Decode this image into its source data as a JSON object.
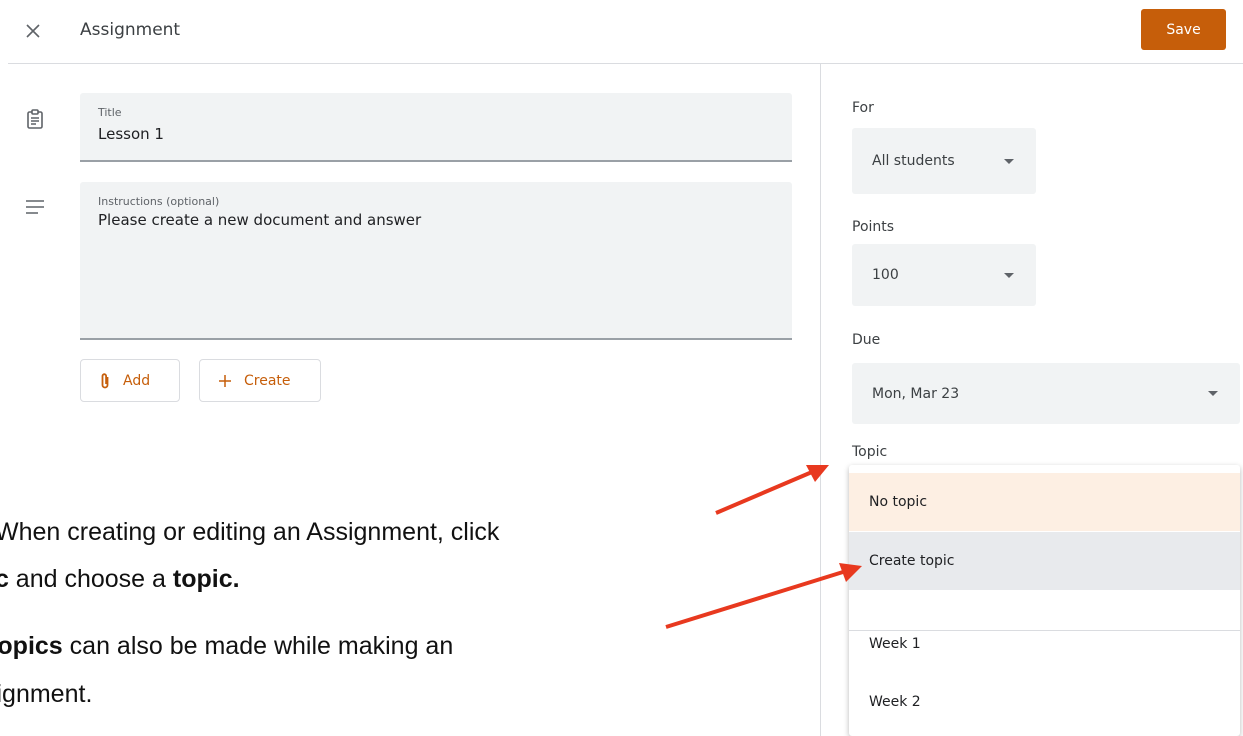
{
  "header": {
    "title": "Assignment",
    "save_label": "Save",
    "close_icon": "close-icon"
  },
  "form": {
    "title_field": {
      "label": "Title",
      "value": "Lesson 1"
    },
    "instructions_field": {
      "label": "Instructions (optional)",
      "value": "Please create a new document and answer"
    },
    "add_label": "Add",
    "create_label": "Create"
  },
  "side": {
    "for": {
      "label": "For",
      "value": "All students"
    },
    "points": {
      "label": "Points",
      "value": "100"
    },
    "due": {
      "label": "Due",
      "value": "Mon, Mar 23"
    },
    "topic": {
      "label": "Topic",
      "options": [
        "No topic",
        "Create topic",
        "Week 1",
        "Week 2"
      ]
    }
  },
  "annotations": {
    "line1": "When creating or editing an Assignment, click",
    "line2_bold": "ic",
    "line2_mid": " and choose a ",
    "line2_bold2": "topic.",
    "line3_bold": "Topics",
    "line3_rest": " can also be made while making an",
    "line4": "signment."
  },
  "colors": {
    "accent": "#c65e0a",
    "field_bg": "#f1f3f4",
    "selected_row": "#fdefe3",
    "hover_row": "#e8eaed",
    "arrow": "#e8391f"
  }
}
